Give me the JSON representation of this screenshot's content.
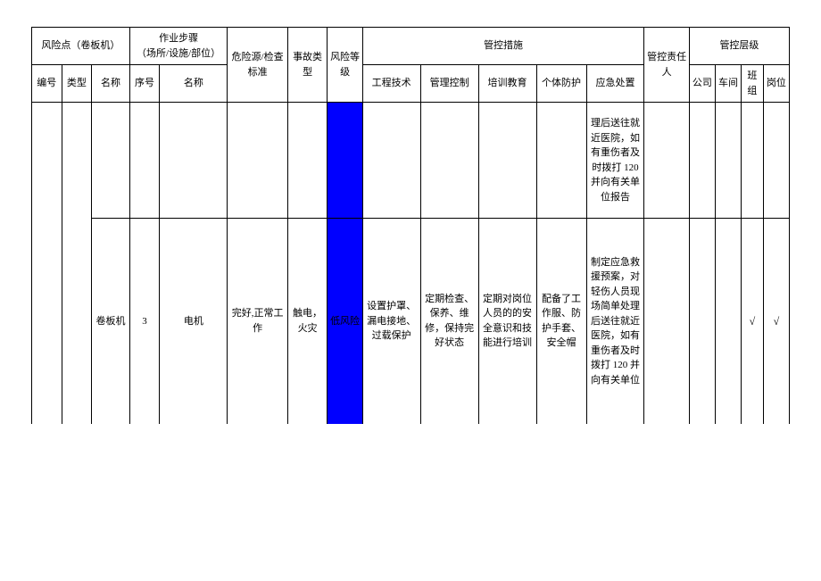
{
  "header": {
    "riskPoint": "风险点（卷板机）",
    "workStep": "作业步骤\n（场所/设施/部位）",
    "hazard": "危险源/检查标准",
    "accident": "事故类型",
    "riskLevel": "风险等级",
    "measures": "管控措施",
    "responsible": "管控责任人",
    "level": "管控层级",
    "sub": {
      "id": "编号",
      "type": "类型",
      "name": "名称",
      "seq": "序号",
      "name2": "名称",
      "eng": "工程技术",
      "mgmt": "管理控制",
      "train": "培训教育",
      "ppe": "个体防护",
      "emerg": "应急处置",
      "company": "公司",
      "workshop": "车间",
      "team": "班组",
      "post": "岗位"
    }
  },
  "rows": [
    {
      "name": "",
      "seq": "",
      "partName": "",
      "hazard": "",
      "accident": "",
      "risk": "",
      "eng": "",
      "mgmt": "",
      "train": "",
      "ppe": "",
      "emerg": "理后送往就近医院，如有重伤者及时拨打 120 并向有关单位报告",
      "responsible": "",
      "company": "",
      "workshop": "",
      "team": "",
      "post": ""
    },
    {
      "name": "卷板机",
      "seq": "3",
      "partName": "电机",
      "hazard": "完好,正常工作",
      "accident": "触电，火灾",
      "risk": "低风险",
      "eng": "设置护罩、漏电接地、过载保护",
      "mgmt": "定期检查、保养、维修，保持完好状态",
      "train": "定期对岗位人员的的安全意识和技能进行培训",
      "ppe": "配备了工作服、防护手套、安全帽",
      "emerg": "制定应急救援预案，对轻伤人员现场简单处理后送往就近医院，如有重伤者及时拨打 120 并向有关单位",
      "responsible": "",
      "company": "",
      "workshop": "",
      "team": "√",
      "post": "√"
    }
  ]
}
